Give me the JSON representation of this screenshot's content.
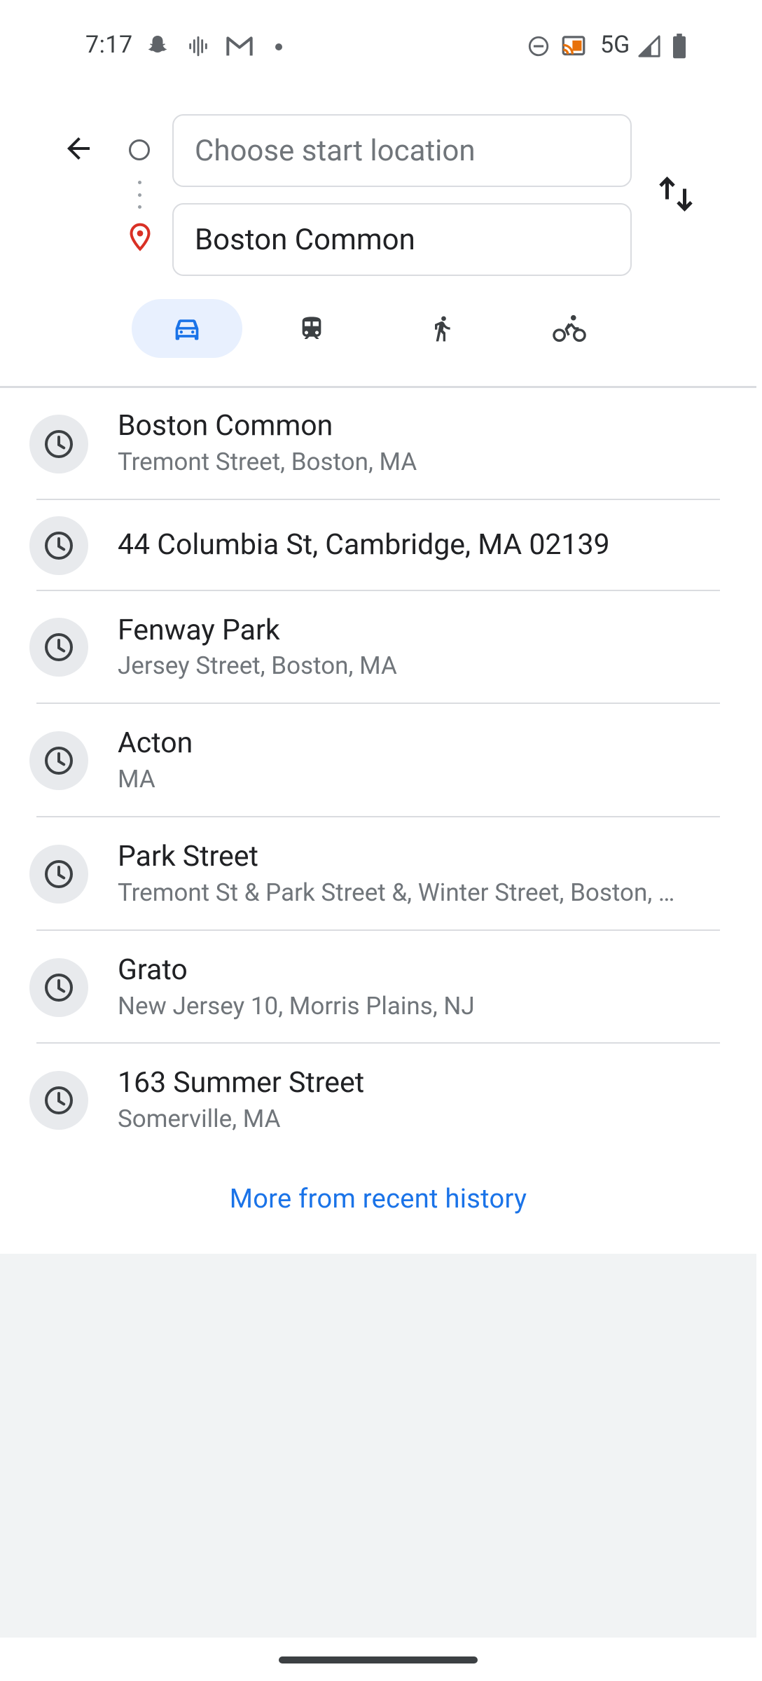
{
  "status_bar": {
    "time": "7:17",
    "network": "5G",
    "icons": [
      "snapchat-icon",
      "voice-icon",
      "gmail-icon",
      "dot-icon",
      "dnd-icon",
      "cast-icon",
      "signal-icon",
      "battery-icon"
    ]
  },
  "search": {
    "start_placeholder": "Choose start location",
    "destination_value": "Boston Common"
  },
  "travel_modes": [
    {
      "name": "drive",
      "icon": "car-icon",
      "selected": true
    },
    {
      "name": "transit",
      "icon": "train-icon",
      "selected": false
    },
    {
      "name": "walk",
      "icon": "walk-icon",
      "selected": false
    },
    {
      "name": "bike",
      "icon": "bike-icon",
      "selected": false
    }
  ],
  "recent_history": [
    {
      "title": "Boston Common",
      "subtitle": "Tremont Street, Boston, MA"
    },
    {
      "title": "44 Columbia St, Cambridge, MA 02139",
      "subtitle": ""
    },
    {
      "title": "Fenway Park",
      "subtitle": "Jersey Street, Boston, MA"
    },
    {
      "title": "Acton",
      "subtitle": "MA"
    },
    {
      "title": "Park Street",
      "subtitle": "Tremont St & Park Street &, Winter Street, Boston, …"
    },
    {
      "title": "Grato",
      "subtitle": "New Jersey 10, Morris Plains, NJ"
    },
    {
      "title": "163 Summer Street",
      "subtitle": "Somerville, MA"
    }
  ],
  "more_link": "More from recent history",
  "colors": {
    "accent": "#1a73e8",
    "selected_mode_bg": "#e8f0fe",
    "pin_red": "#d93025"
  }
}
